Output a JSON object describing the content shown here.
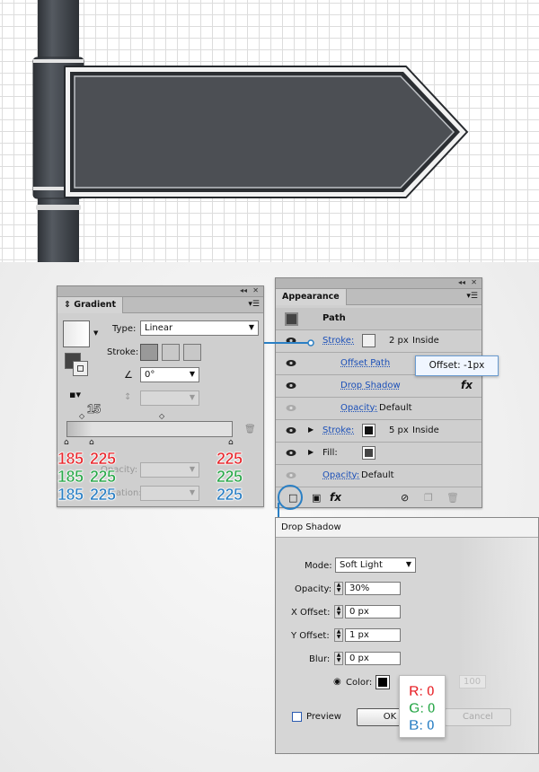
{
  "gradient_panel": {
    "tab": "Gradient",
    "type_label": "Type:",
    "type_value": "Linear",
    "stroke_label": "Stroke:",
    "angle_value": "0°",
    "location_number": "15",
    "dim_label_opacity": "Opacity:",
    "dim_label_location": "Location:"
  },
  "appearance_panel": {
    "tab": "Appearance",
    "header": "Path",
    "stroke1_label": "Stroke:",
    "stroke1_weight": "2 px",
    "stroke1_align": "Inside",
    "offset_path_label": "Offset Path",
    "offset_tooltip": "Offset: -1px",
    "drop_shadow_label": "Drop Shadow",
    "fx_label": "fx",
    "opacity1_label": "Opacity:",
    "opacity1_value": "Default",
    "stroke2_label": "Stroke:",
    "stroke2_weight": "5 px",
    "stroke2_align": "Inside",
    "fill_label": "Fill:",
    "opacity2_label": "Opacity:",
    "opacity2_value": "Default",
    "bottom_fx": "fx"
  },
  "annotations": {
    "red_left1": "185",
    "red_left2": "225",
    "red_right": "225",
    "green_left1": "185",
    "green_left2": "225",
    "green_right": "225",
    "blue_left1": "185",
    "blue_left2": "225",
    "blue_right": "225",
    "r_label": "R: 0",
    "g_label": "G: 0",
    "b_label": "B: 0"
  },
  "drop_shadow_dialog": {
    "title": "Drop Shadow",
    "mode_label": "Mode:",
    "mode_value": "Soft Light",
    "opacity_label": "Opacity:",
    "opacity_value": "30%",
    "x_label": "X Offset:",
    "x_value": "0 px",
    "y_label": "Y Offset:",
    "y_value": "1 px",
    "blur_label": "Blur:",
    "blur_value": "0 px",
    "color_label": "Color:",
    "darkness_value": "100",
    "preview_label": "Preview",
    "ok_label": "OK",
    "cancel_label": "Cancel"
  },
  "colors": {
    "sign_fill": "#4c4f54",
    "pole_fill": "#3e4349",
    "accent_blue": "#1a4fb8"
  }
}
